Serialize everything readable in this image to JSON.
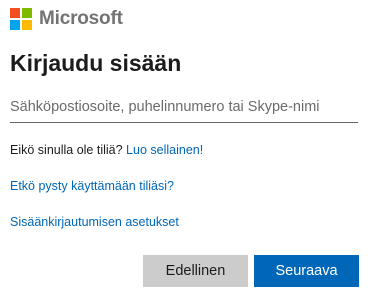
{
  "brand": {
    "name": "Microsoft",
    "logo_colors": [
      "#f25022",
      "#7fba00",
      "#00a4ef",
      "#ffb900"
    ],
    "text_color": "#737373"
  },
  "title": "Kirjaudu sisään",
  "account_input": {
    "placeholder": "Sähköpostiosoite, puhelinnumero tai Skype-nimi",
    "value": ""
  },
  "no_account": {
    "text": "Eikö sinulla ole tiliä?",
    "link": "Luo sellainen!"
  },
  "cant_access_link": "Etkö pysty käyttämään tiliäsi?",
  "signin_options_link": "Sisäänkirjautumisen asetukset",
  "buttons": {
    "back": "Edellinen",
    "next": "Seuraava"
  },
  "colors": {
    "accent": "#0067b8",
    "secondary_button": "#cccccc"
  }
}
